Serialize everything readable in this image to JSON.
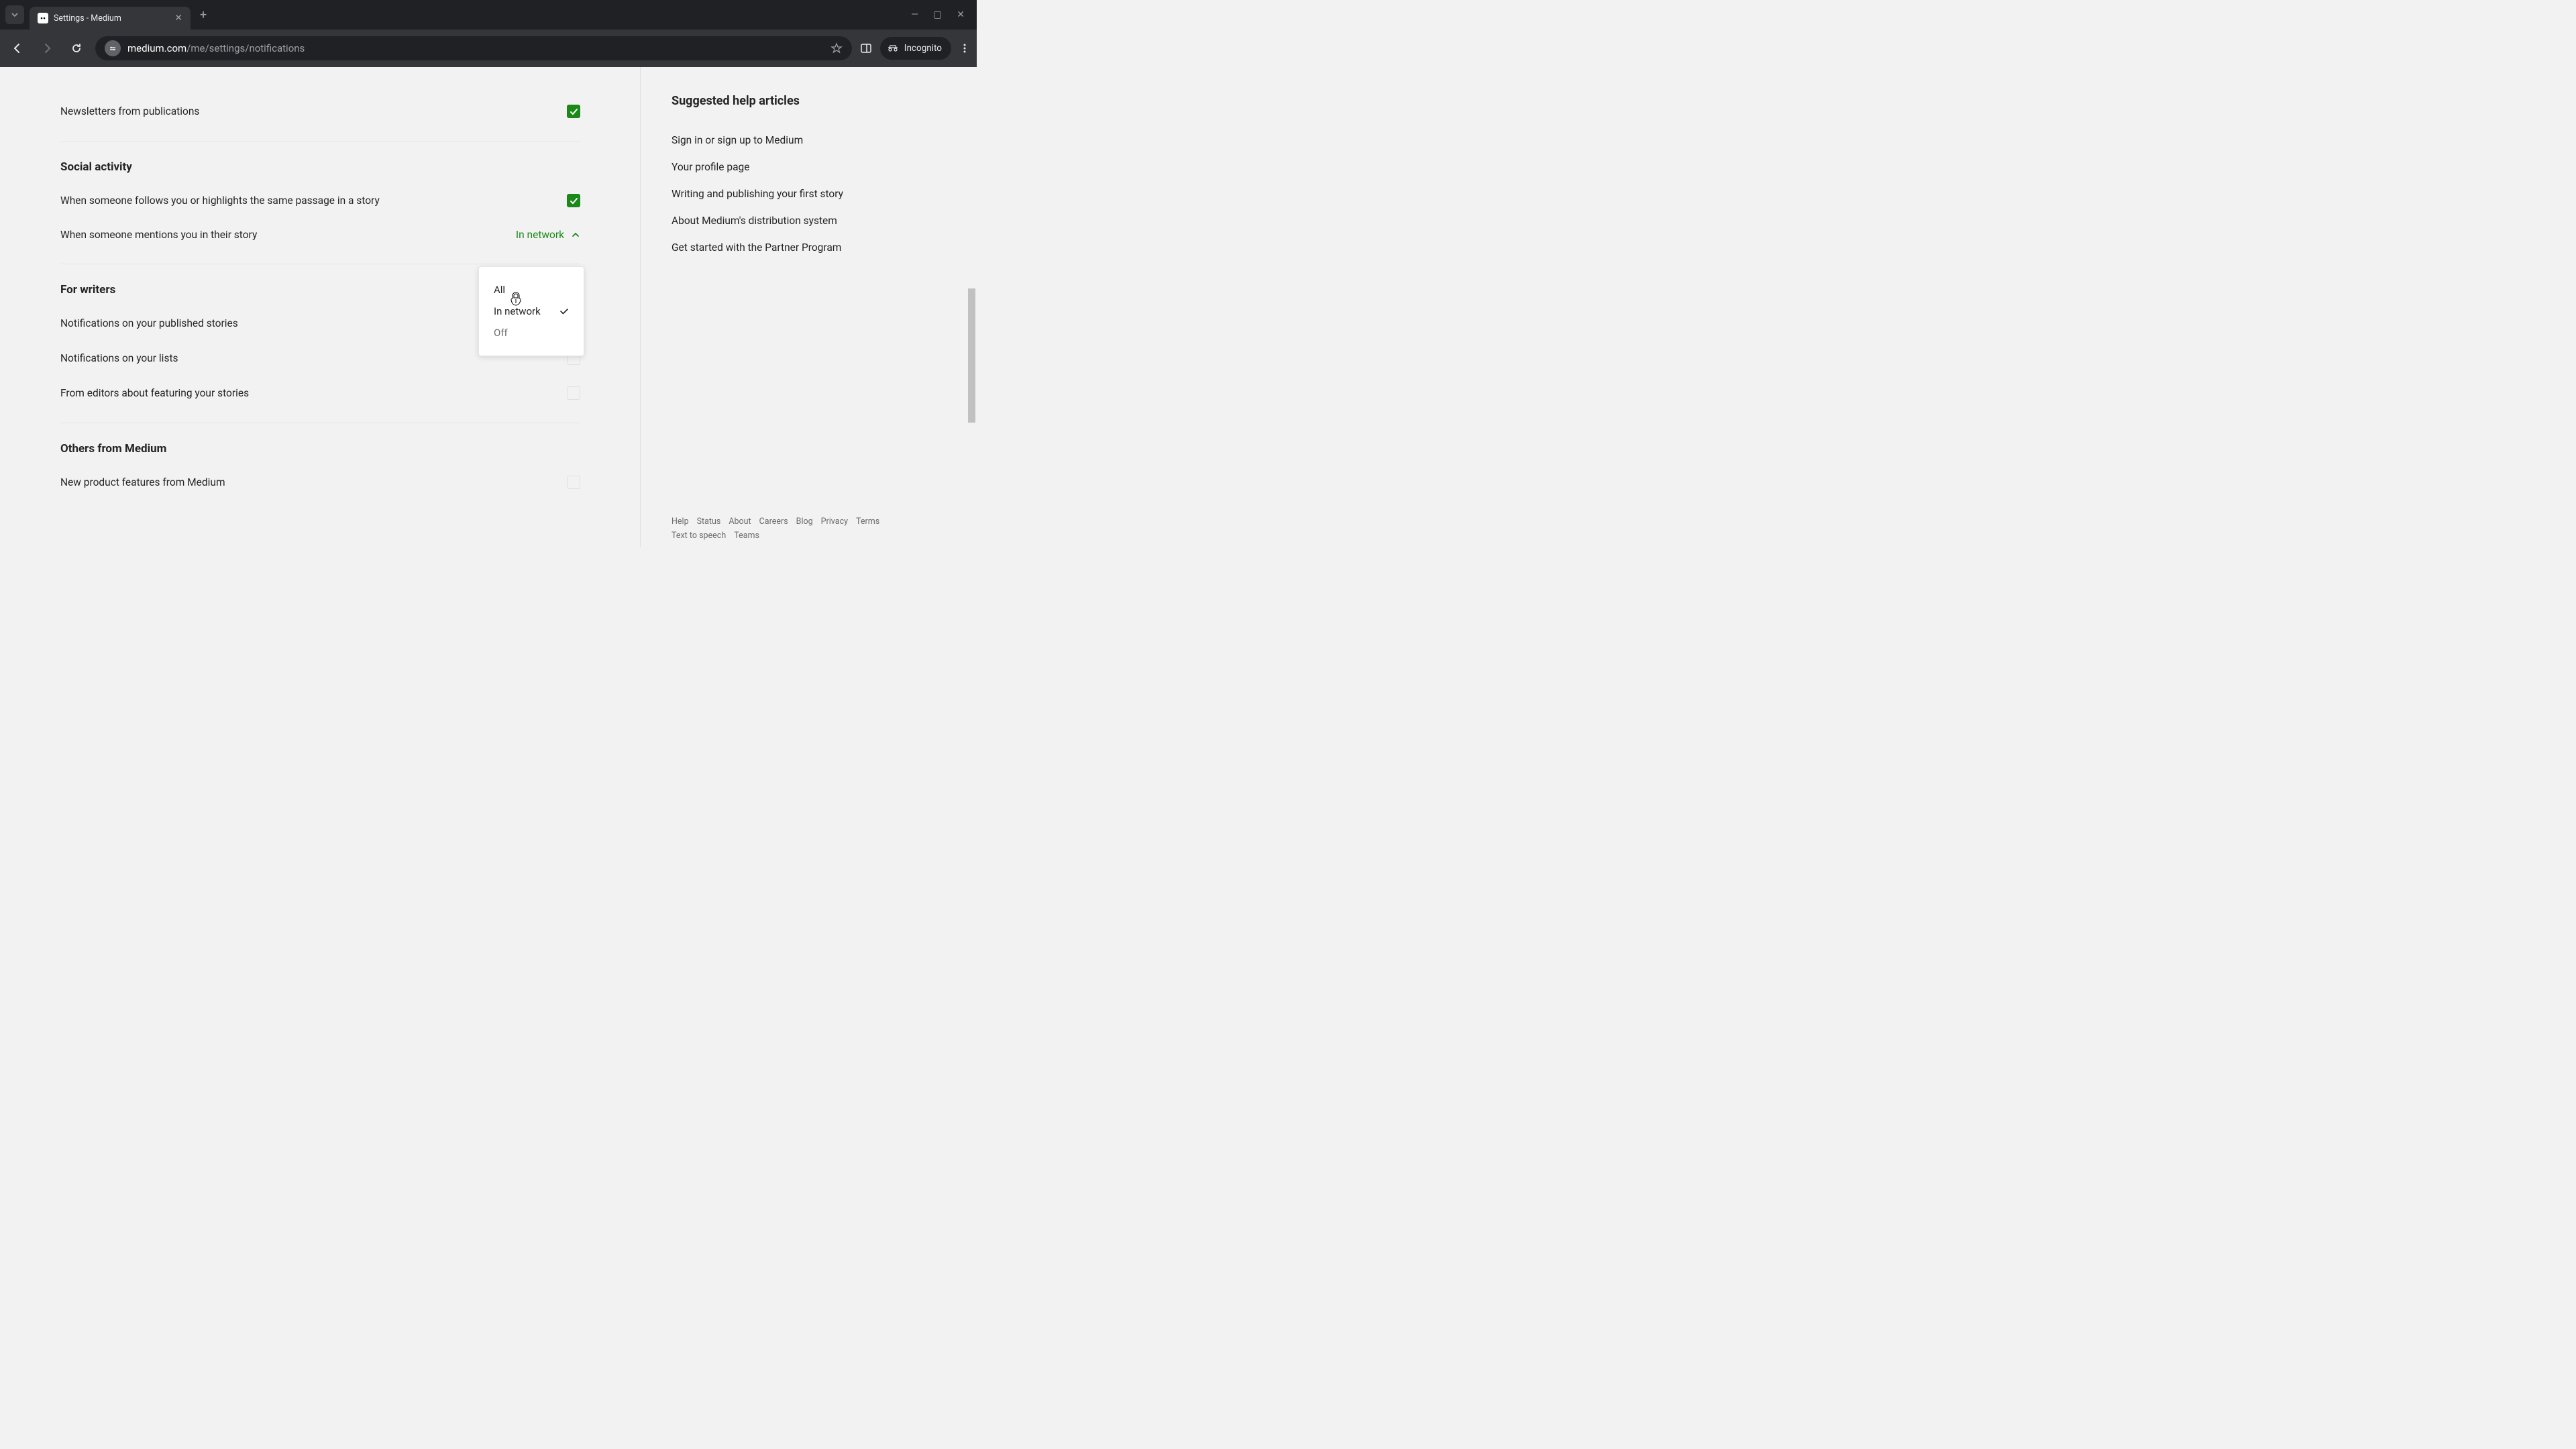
{
  "browser": {
    "tab_title": "Settings - Medium",
    "url_domain": "medium.com",
    "url_path": "/me/settings/notifications",
    "incognito_label": "Incognito"
  },
  "settings": {
    "newsletters_label": "Newsletters from publications",
    "section_social": "Social activity",
    "follows_label": "When someone follows you or highlights the same passage in a story",
    "mentions_label": "When someone mentions you in their story",
    "mentions_value": "In network",
    "section_writers": "For writers",
    "published_label": "Notifications on your published stories",
    "lists_label": "Notifications on your lists",
    "editors_label": "From editors about featuring your stories",
    "section_others": "Others from Medium",
    "new_features_label": "New product features from Medium"
  },
  "dropdown": {
    "opt_all": "All",
    "opt_in_network": "In network",
    "opt_off": "Off"
  },
  "sidebar": {
    "heading": "Suggested help articles",
    "links": {
      "signin": "Sign in or sign up to Medium",
      "profile": "Your profile page",
      "writing": "Writing and publishing your first story",
      "distribution": "About Medium's distribution system",
      "partner": "Get started with the Partner Program"
    }
  },
  "footer": {
    "help": "Help",
    "status": "Status",
    "about": "About",
    "careers": "Careers",
    "blog": "Blog",
    "privacy": "Privacy",
    "terms": "Terms",
    "tts": "Text to speech",
    "teams": "Teams"
  }
}
